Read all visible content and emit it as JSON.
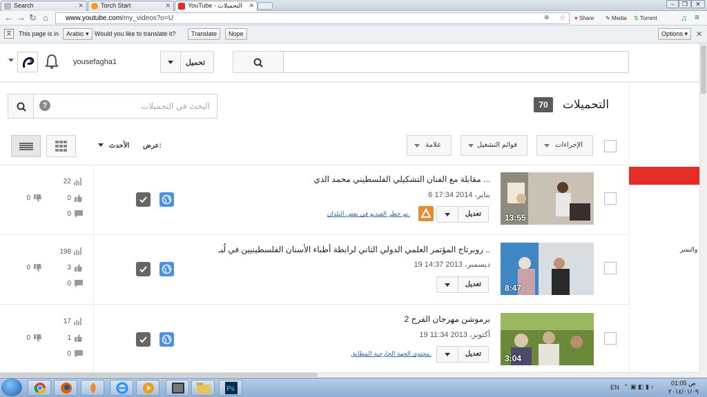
{
  "browser": {
    "tabs": [
      {
        "title": "Search"
      },
      {
        "title": "Torch Start"
      },
      {
        "title": "YouTube - التحميلات"
      }
    ],
    "url_host": "www.youtube.com",
    "url_path": "/my_videos?o=U",
    "extensions": {
      "share": "Share",
      "media": "Media",
      "torrent": "Torrent"
    }
  },
  "translate_bar": {
    "prefix": "This page is in",
    "language": "Arabic",
    "question": "Would you like to translate it?",
    "translate": "Translate",
    "nope": "Nope",
    "options": "Options"
  },
  "masthead": {
    "username": "yousefagha1",
    "upload_label": "تحميل"
  },
  "page": {
    "title": "التحميلات",
    "count": "70",
    "search_placeholder": "البحث في التحميلات",
    "toolbar": {
      "actions": "الإجراءات",
      "playlists": "قوائم التشغيل",
      "tag": "علامة"
    },
    "view_label": "عرض:",
    "sort_label": "الأحدث"
  },
  "videos": [
    {
      "title": "مقابلة مع الفنان التشكيلي الفلسطيني محمد الدي ...",
      "date": "6 يناير، 2014 17:34",
      "duration": "13:55",
      "edit": "تعديل",
      "notice": "تم حظر الفيديو في بعض البلدان.",
      "views": "22",
      "likes": "0",
      "dislikes": "0",
      "comments": "0"
    },
    {
      "title": "روبرتاج المؤتمر العلمي الدولي الثاني لرابطة أطباء الأسنان الفلسطينيين في لُبـ ..",
      "date": "19 ديسمبر، 2013 14:37",
      "duration": "8:47",
      "edit": "تعديل",
      "notice": "",
      "views": "198",
      "likes": "3",
      "dislikes": "0",
      "comments": "0"
    },
    {
      "title": "برموشن مهرجان الفرح 2",
      "date": "19 أكتوبر، 2013 11:34",
      "duration": "3:04",
      "edit": "تعديل",
      "notice": "محتوى الجهة الخارجية المطابق.",
      "views": "17",
      "likes": "1",
      "dislikes": "0",
      "comments": "0"
    }
  ],
  "sidebar": {
    "text": "والنشر"
  },
  "taskbar": {
    "lang": "EN",
    "time": "01:05 ص",
    "date": "٢٠١٤/٠١/٠٩"
  }
}
